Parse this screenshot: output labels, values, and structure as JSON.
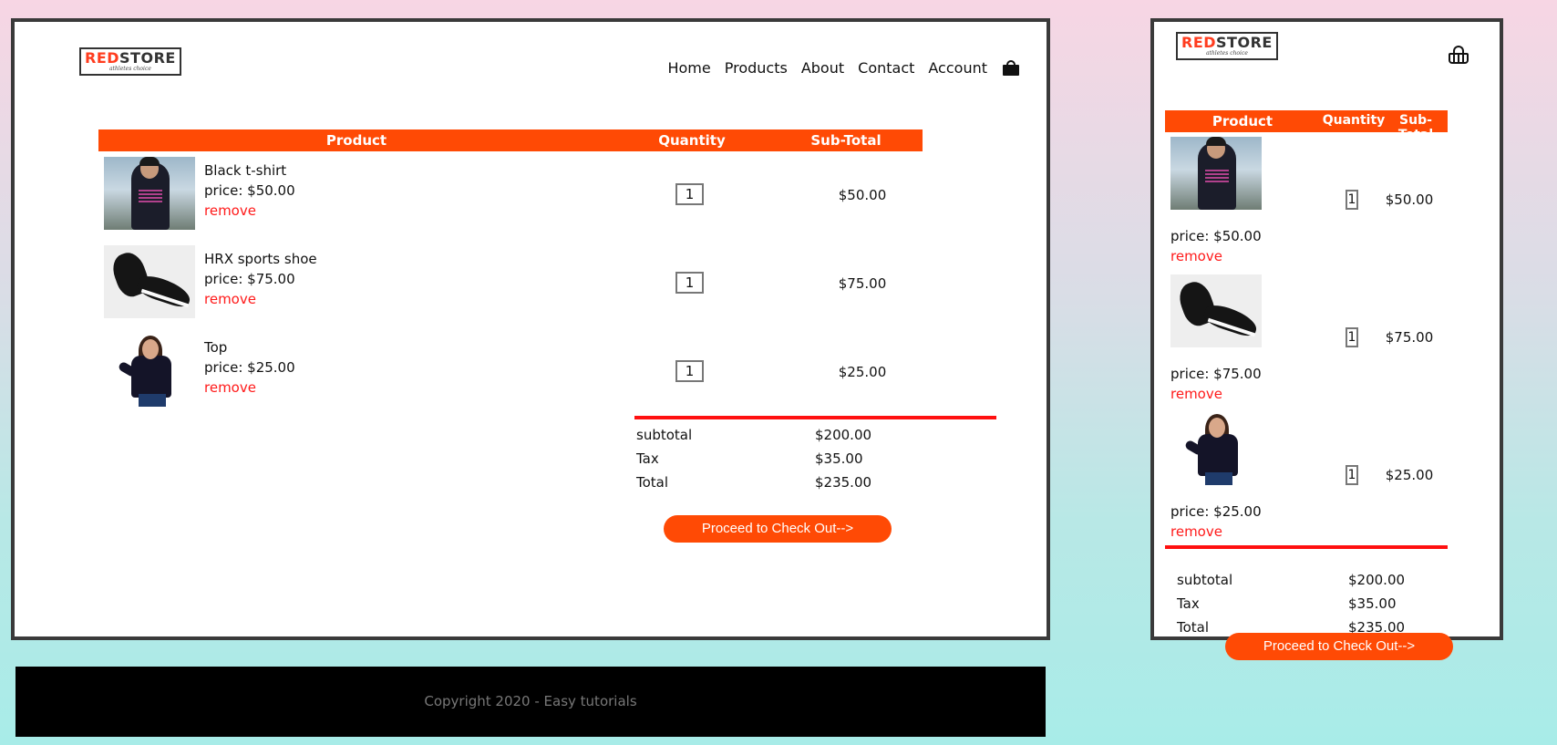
{
  "logo": {
    "red": "RED",
    "gray": "STORE",
    "tagline": "athletes choice"
  },
  "nav": {
    "items": [
      "Home",
      "Products",
      "About",
      "Contact",
      "Account"
    ],
    "cart_icon": "shopping-bag-icon"
  },
  "cart": {
    "headers": {
      "product": "Product",
      "quantity": "Quantity",
      "subtotal": "Sub-Total"
    },
    "items": [
      {
        "name": "Black t-shirt",
        "price": "price: $50.00",
        "remove": "remove",
        "qty": "1",
        "subtotal": "$50.00"
      },
      {
        "name": "HRX sports shoe",
        "price": "price: $75.00",
        "remove": "remove",
        "qty": "1",
        "subtotal": "$75.00"
      },
      {
        "name": "Top",
        "price": "price: $25.00",
        "remove": "remove",
        "qty": "1",
        "subtotal": "$25.00"
      }
    ],
    "totals": {
      "subtotal_label": "subtotal",
      "subtotal_value": "$200.00",
      "tax_label": "Tax",
      "tax_value": "$35.00",
      "total_label": "Total",
      "total_value": "$235.00"
    },
    "checkout": "Proceed to Check Out-->"
  },
  "mobile": {
    "cart_icon": "basket-icon"
  },
  "footer": {
    "copyright": "Copyright 2020 - Easy tutorials"
  },
  "colors": {
    "accent": "#ff4a05",
    "remove": "#ff1a1a",
    "rule": "#ff1010"
  }
}
